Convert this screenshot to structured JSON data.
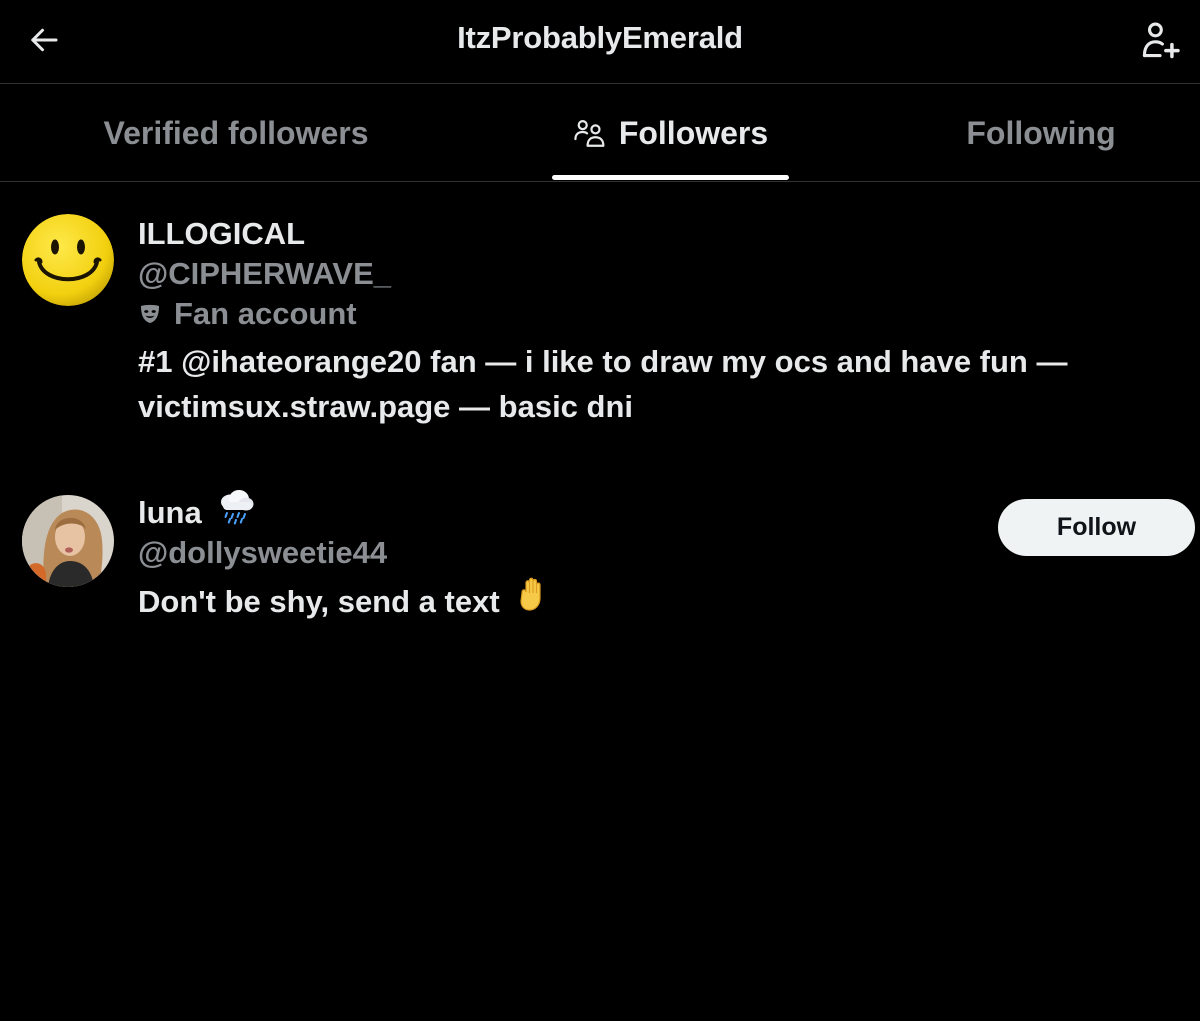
{
  "header": {
    "title": "ItzProbablyEmerald",
    "back_icon": "arrow-left-icon",
    "add_user_icon": "person-add-icon"
  },
  "tabs": [
    {
      "label": "Verified followers",
      "active": false
    },
    {
      "label": "Followers",
      "active": true,
      "icon": "people-icon"
    },
    {
      "label": "Following",
      "active": false
    }
  ],
  "users": [
    {
      "display_name": "ILLOGICAL",
      "handle": "@CIPHERWAVE_",
      "label": "Fan account",
      "label_icon": "theater-mask-icon",
      "bio": "#1 @ihateorange20 fan — i like to draw my ocs and have fun — victimsux.straw.page — basic dni",
      "avatar": "smiley-face-avatar"
    },
    {
      "display_name": "luna",
      "name_emoji": "cloud-rain-icon",
      "handle": "@dollysweetie44",
      "bio": "Don't be shy, send a text",
      "bio_emoji": "raised-hand-icon",
      "follow_label": "Follow",
      "avatar": "photo-avatar"
    }
  ],
  "colors": {
    "background": "#000000",
    "primary_text": "#e7e9ea",
    "secondary_text": "#8b8f93",
    "divider": "#2f3336",
    "follow_button_bg": "#eff3f4",
    "avatar_yellow": "#f7d812"
  }
}
